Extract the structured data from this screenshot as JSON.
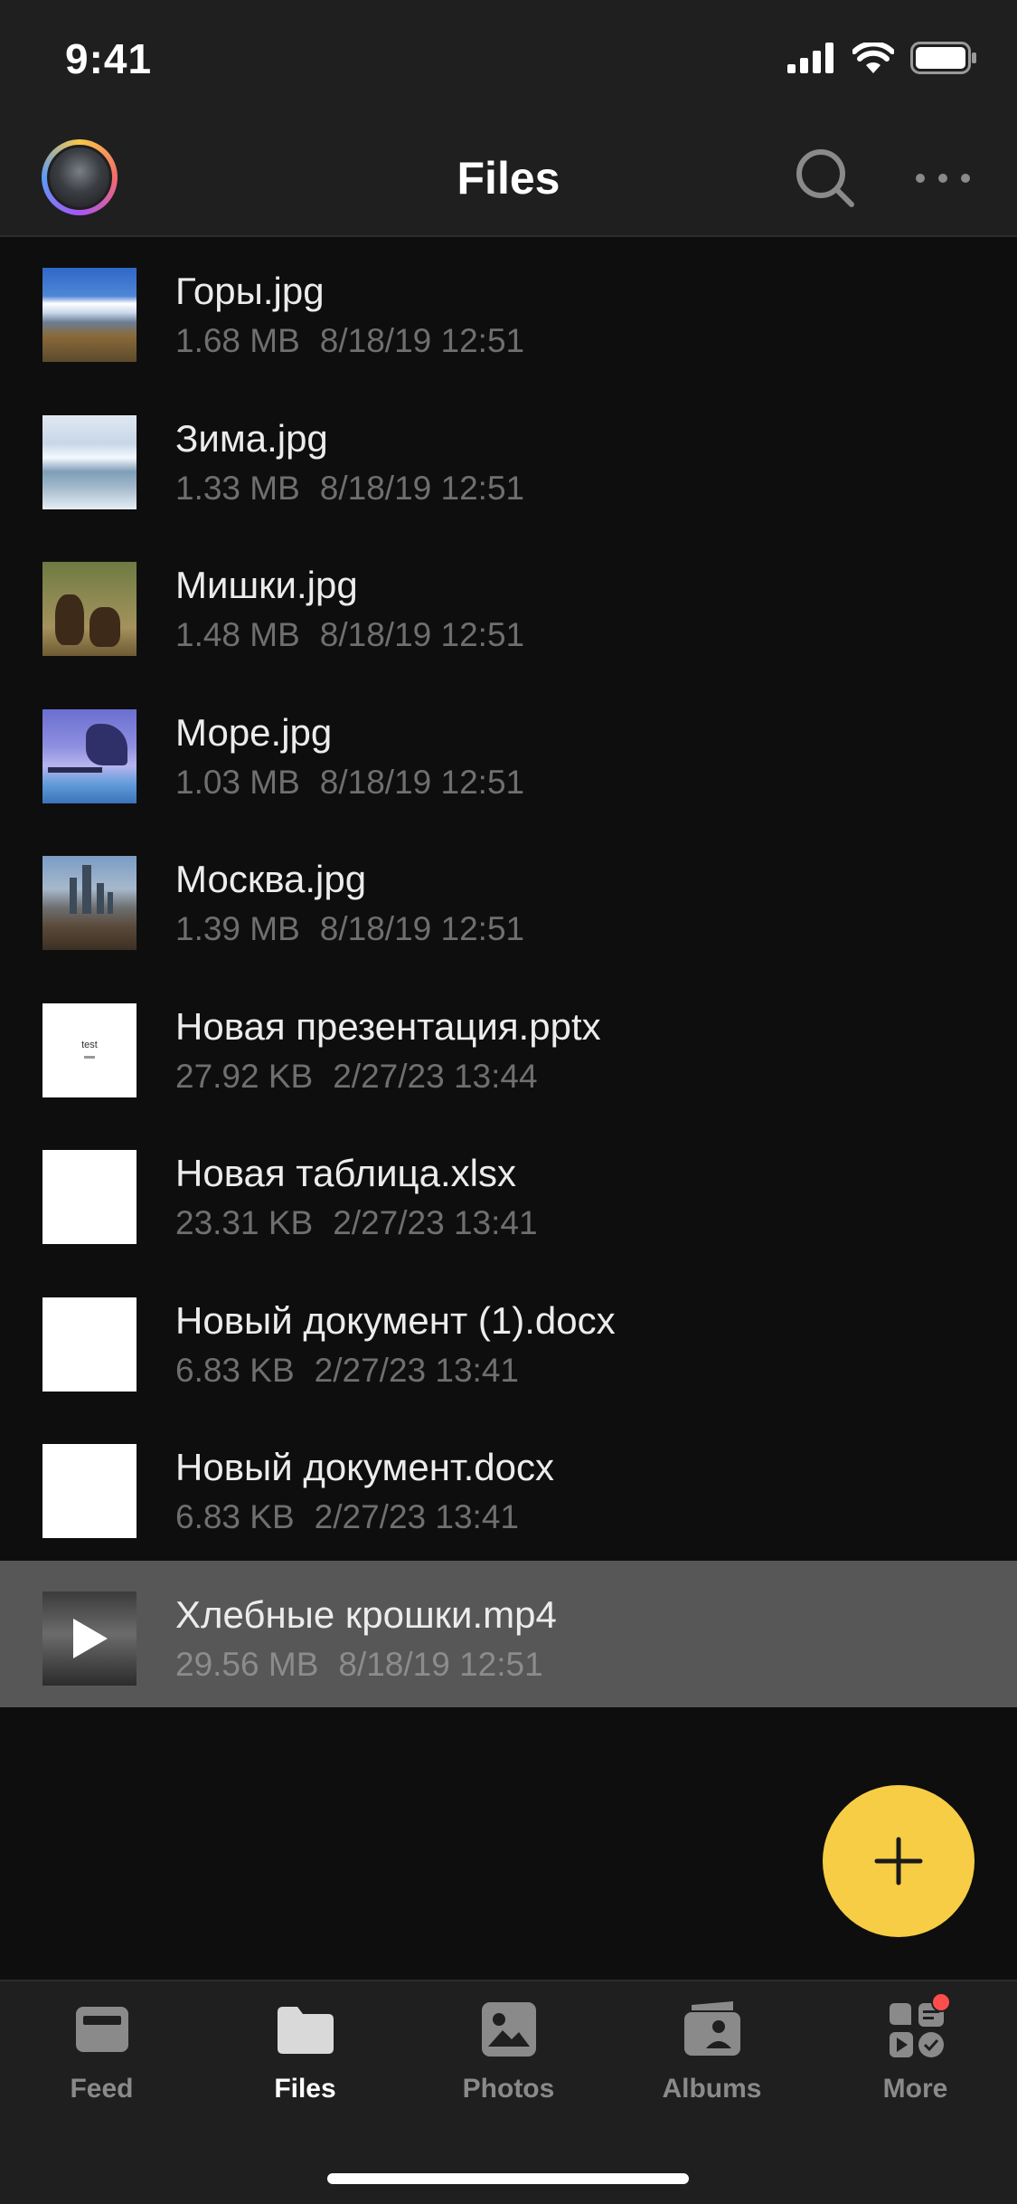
{
  "status_bar": {
    "time": "9:41"
  },
  "header": {
    "title": "Files"
  },
  "files": [
    {
      "name": "Горы.jpg",
      "size": "1.68 MB",
      "date": "8/18/19 12:51",
      "thumb": "mountains"
    },
    {
      "name": "Зима.jpg",
      "size": "1.33 MB",
      "date": "8/18/19 12:51",
      "thumb": "winter"
    },
    {
      "name": "Мишки.jpg",
      "size": "1.48 MB",
      "date": "8/18/19 12:51",
      "thumb": "bears"
    },
    {
      "name": "Море.jpg",
      "size": "1.03 MB",
      "date": "8/18/19 12:51",
      "thumb": "sea"
    },
    {
      "name": "Москва.jpg",
      "size": "1.39 MB",
      "date": "8/18/19 12:51",
      "thumb": "moscow"
    },
    {
      "name": "Новая презентация.pptx",
      "size": "27.92 KB",
      "date": "2/27/23 13:44",
      "thumb": "pptx",
      "thumb_text": "test"
    },
    {
      "name": "Новая таблица.xlsx",
      "size": "23.31 KB",
      "date": "2/27/23 13:41",
      "thumb": "white"
    },
    {
      "name": "Новый документ (1).docx",
      "size": "6.83 KB",
      "date": "2/27/23 13:41",
      "thumb": "white"
    },
    {
      "name": "Новый документ.docx",
      "size": "6.83 KB",
      "date": "2/27/23 13:41",
      "thumb": "white"
    },
    {
      "name": "Хлебные крошки.mp4",
      "size": "29.56 MB",
      "date": "8/18/19 12:51",
      "thumb": "video",
      "selected": true
    }
  ],
  "fab": {
    "icon": "plus-icon",
    "color": "#f7cd45"
  },
  "tabs": [
    {
      "label": "Feed",
      "icon": "feed-icon",
      "active": false
    },
    {
      "label": "Files",
      "icon": "folder-icon",
      "active": true
    },
    {
      "label": "Photos",
      "icon": "photo-icon",
      "active": false
    },
    {
      "label": "Albums",
      "icon": "albums-icon",
      "active": false
    },
    {
      "label": "More",
      "icon": "more-grid-icon",
      "active": false,
      "badge": true
    }
  ],
  "colors": {
    "background": "#0e0e0e",
    "bar": "#1f1f1f",
    "selected_row": "#575757",
    "accent": "#f7cd45",
    "badge": "#ff4d4d"
  }
}
